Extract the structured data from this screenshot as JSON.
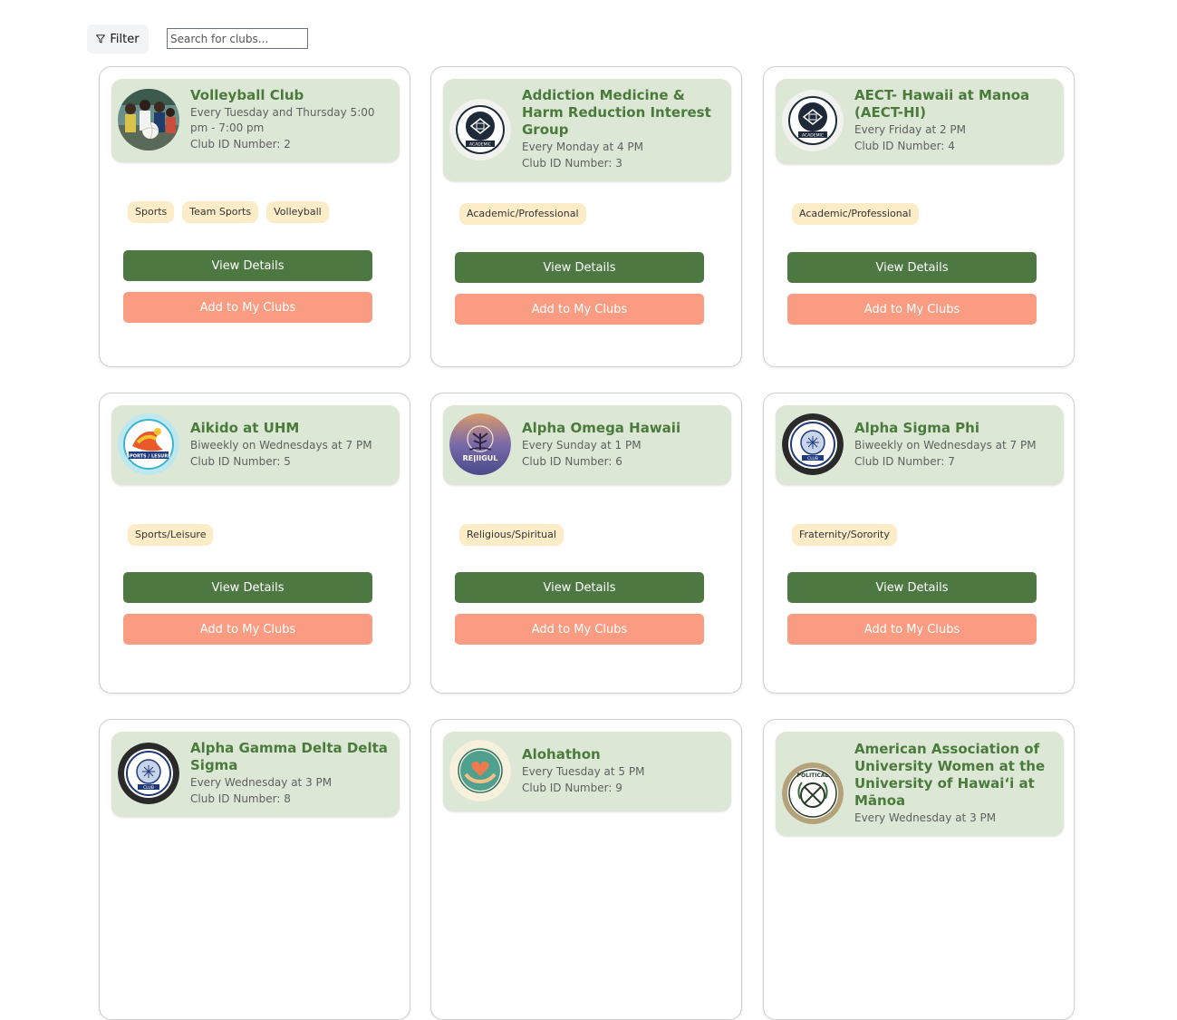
{
  "toolbar": {
    "filter_label": "Filter",
    "search_placeholder": "Search for clubs..."
  },
  "colors": {
    "header_bg": "#dce8d5",
    "name_green": "#4a7a3c",
    "details_button": "#4e7842",
    "add_button": "#fa9c82",
    "tag_bg": "#fdecc8"
  },
  "buttons": {
    "view_details": "View Details",
    "add_to_my_clubs": "Add to My Clubs"
  },
  "clubs": [
    {
      "name": "Volleyball Club",
      "schedule": "Every Tuesday and Thursday 5:00 pm - 7:00 pm",
      "club_id": "Club ID Number: 2",
      "tags": [
        "Sports",
        "Team Sports",
        "Volleyball"
      ],
      "logo": "volleyball-photo"
    },
    {
      "name": "Addiction Medicine & Harm Reduction Interest Group",
      "schedule": "Every Monday at 4 PM",
      "club_id": "Club ID Number: 3",
      "tags": [
        "Academic/Professional"
      ],
      "logo": "academic-seal"
    },
    {
      "name": "AECT- Hawaii at Manoa (AECT-HI)",
      "schedule": "Every Friday at 2 PM",
      "club_id": "Club ID Number: 4",
      "tags": [
        "Academic/Professional"
      ],
      "logo": "academic-seal"
    },
    {
      "name": "Aikido at UHM",
      "schedule": "Biweekly on Wednesdays at 7 PM",
      "club_id": "Club ID Number: 5",
      "tags": [
        "Sports/Leisure"
      ],
      "logo": "sports-leisure-badge"
    },
    {
      "name": "Alpha Omega Hawaii",
      "schedule": "Every Sunday at 1 PM",
      "club_id": "Club ID Number: 6",
      "tags": [
        "Religious/Spiritual"
      ],
      "logo": "religious-tree-badge"
    },
    {
      "name": "Alpha Sigma Phi",
      "schedule": "Biweekly on Wednesdays at 7 PM",
      "club_id": "Club ID Number: 7",
      "tags": [
        "Fraternity/Sorority"
      ],
      "logo": "fraternity-seal"
    },
    {
      "name": "Alpha Gamma Delta Delta Sigma",
      "schedule": "Every Wednesday at 3 PM",
      "club_id": "Club ID Number: 8",
      "tags": [],
      "logo": "fraternity-seal"
    },
    {
      "name": "Alohathon",
      "schedule": "Every Tuesday at 5 PM",
      "club_id": "Club ID Number: 9",
      "tags": [],
      "logo": "heart-hands-badge"
    },
    {
      "name": "American Association of University Women at the University of Hawaiʻi at Mānoa",
      "schedule": "Every Wednesday at 3 PM",
      "club_id": "",
      "tags": [],
      "logo": "political-club-seal"
    }
  ]
}
